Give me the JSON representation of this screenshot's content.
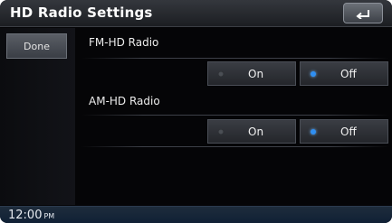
{
  "header": {
    "title": "HD Radio Settings",
    "back_icon": "back-arrow-icon"
  },
  "sidebar": {
    "done_label": "Done"
  },
  "sections": [
    {
      "label": "FM-HD Radio",
      "options": [
        {
          "label": "On",
          "selected": false
        },
        {
          "label": "Off",
          "selected": true
        }
      ]
    },
    {
      "label": "AM-HD Radio",
      "options": [
        {
          "label": "On",
          "selected": false
        },
        {
          "label": "Off",
          "selected": true
        }
      ]
    }
  ],
  "status": {
    "time": "12:00",
    "ampm": "PM"
  },
  "colors": {
    "selected_indicator": "#2f8ff2",
    "unselected_indicator": "#4b4f55",
    "status_bar": "#102035"
  }
}
